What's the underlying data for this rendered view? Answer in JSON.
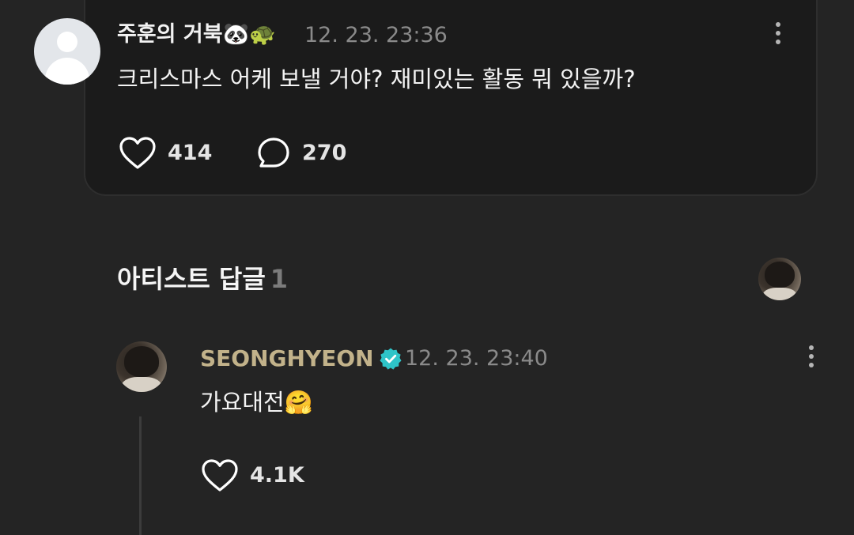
{
  "post": {
    "author": "주훈의 거북🐼🐢",
    "time": "12. 23. 23:36",
    "text": "크리스마스 어케 보낼 거야? 재미있는 활동 뭐 있을까?",
    "likes": "414",
    "comments": "270"
  },
  "artist_replies": {
    "title": "아티스트 답글",
    "count": "1"
  },
  "reply": {
    "author": "SEONGHYEON",
    "verified_icon": "verified-badge-icon",
    "time": "12. 23. 23:40",
    "text": "가요대전🤗",
    "likes": "4.1K"
  },
  "colors": {
    "background": "#242424",
    "card": "#1b1b1b",
    "artist_name": "#c2b28a",
    "verified_badge": "#2ec4c8",
    "muted_text": "#8a8a8a"
  }
}
